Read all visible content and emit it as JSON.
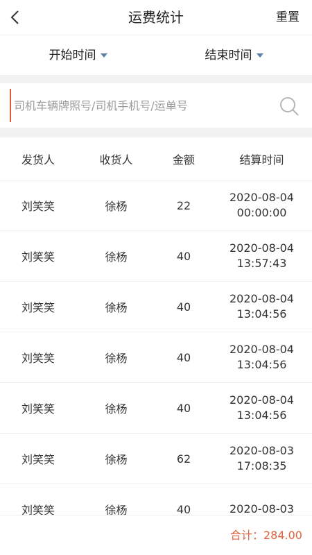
{
  "header": {
    "back_icon": "chevron-left-icon",
    "title": "运费统计",
    "reset_label": "重置"
  },
  "filters": {
    "start_label": "开始时间",
    "end_label": "结束时间"
  },
  "search": {
    "placeholder": "司机车辆牌照号/司机手机号/运单号",
    "icon": "search-icon"
  },
  "table": {
    "headers": [
      "发货人",
      "收货人",
      "金额",
      "结算时间"
    ],
    "rows": [
      {
        "sender": "刘笑笑",
        "receiver": "徐杨",
        "amount": "22",
        "date": "2020-08-04",
        "time": "00:00:00"
      },
      {
        "sender": "刘笑笑",
        "receiver": "徐杨",
        "amount": "40",
        "date": "2020-08-04",
        "time": "13:57:43"
      },
      {
        "sender": "刘笑笑",
        "receiver": "徐杨",
        "amount": "40",
        "date": "2020-08-04",
        "time": "13:04:56"
      },
      {
        "sender": "刘笑笑",
        "receiver": "徐杨",
        "amount": "40",
        "date": "2020-08-04",
        "time": "13:04:56"
      },
      {
        "sender": "刘笑笑",
        "receiver": "徐杨",
        "amount": "40",
        "date": "2020-08-04",
        "time": "13:04:56"
      },
      {
        "sender": "刘笑笑",
        "receiver": "徐杨",
        "amount": "62",
        "date": "2020-08-03",
        "time": "17:08:35"
      },
      {
        "sender": "刘笑笑",
        "receiver": "徐杨",
        "amount": "40",
        "date": "2020-08-03",
        "time": ""
      }
    ]
  },
  "footer": {
    "total_label": "合计：284.00"
  },
  "colors": {
    "accent": "#e0623e",
    "caret": "#5a7fa6",
    "separator": "#f2f2f2"
  }
}
